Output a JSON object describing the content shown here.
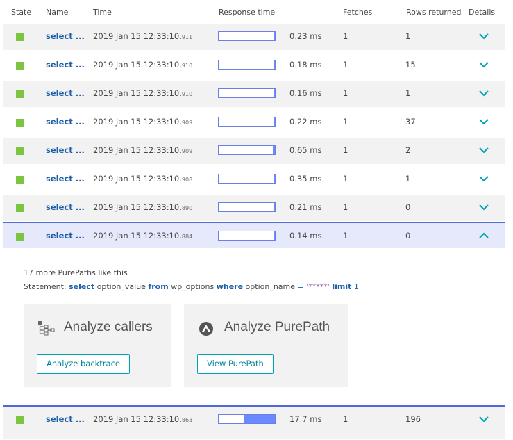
{
  "header": {
    "state": "State",
    "name": "Name",
    "time": "Time",
    "response_time": "Response time",
    "fetches": "Fetches",
    "rows_returned": "Rows returned",
    "details": "Details"
  },
  "rows": [
    {
      "name": "select ...",
      "time": "2019 Jan 15 12:33:10.",
      "ms": "911",
      "response": "0.23 ms",
      "bar_fraction": 0.013,
      "fetches": "1",
      "rows": "1",
      "expanded": false
    },
    {
      "name": "select ...",
      "time": "2019 Jan 15 12:33:10.",
      "ms": "910",
      "response": "0.18 ms",
      "bar_fraction": 0.01,
      "fetches": "1",
      "rows": "15",
      "expanded": false
    },
    {
      "name": "select ...",
      "time": "2019 Jan 15 12:33:10.",
      "ms": "910",
      "response": "0.16 ms",
      "bar_fraction": 0.009,
      "fetches": "1",
      "rows": "1",
      "expanded": false
    },
    {
      "name": "select ...",
      "time": "2019 Jan 15 12:33:10.",
      "ms": "909",
      "response": "0.22 ms",
      "bar_fraction": 0.012,
      "fetches": "1",
      "rows": "37",
      "expanded": false
    },
    {
      "name": "select ...",
      "time": "2019 Jan 15 12:33:10.",
      "ms": "909",
      "response": "0.65 ms",
      "bar_fraction": 0.037,
      "fetches": "1",
      "rows": "2",
      "expanded": false
    },
    {
      "name": "select ...",
      "time": "2019 Jan 15 12:33:10.",
      "ms": "908",
      "response": "0.35 ms",
      "bar_fraction": 0.02,
      "fetches": "1",
      "rows": "1",
      "expanded": false
    },
    {
      "name": "select ...",
      "time": "2019 Jan 15 12:33:10.",
      "ms": "890",
      "response": "0.21 ms",
      "bar_fraction": 0.012,
      "fetches": "1",
      "rows": "0",
      "expanded": false
    },
    {
      "name": "select ...",
      "time": "2019 Jan 15 12:33:10.",
      "ms": "884",
      "response": "0.14 ms",
      "bar_fraction": 0.008,
      "fetches": "1",
      "rows": "0",
      "expanded": true
    }
  ],
  "detail": {
    "more_purepaths": "17 more PurePaths like this",
    "statement_label": "Statement:",
    "statement_parts": {
      "kw_select": "select",
      "col": "option_value",
      "kw_from": "from",
      "table": "wp_options",
      "kw_where": "where",
      "cond_col": "option_name",
      "op": "=",
      "literal": "'*****'",
      "kw_limit": "limit",
      "limit_val": "1"
    },
    "card_callers": {
      "title": "Analyze callers",
      "button": "Analyze backtrace",
      "icon": "callers-tree-icon"
    },
    "card_purepath": {
      "title": "Analyze PurePath",
      "button": "View PurePath",
      "icon": "purepath-icon"
    }
  },
  "last_row": {
    "name": "select ...",
    "time": "2019 Jan 15 12:33:10.",
    "ms": "863",
    "response": "17.7 ms",
    "bar_fraction": 0.56,
    "fetches": "1",
    "rows": "196",
    "expanded": false
  },
  "colors": {
    "state_ok": "#7dc540",
    "accent_blue": "#5069d8",
    "link_teal": "#00a1b2",
    "name_blue": "#1b5ea8"
  }
}
